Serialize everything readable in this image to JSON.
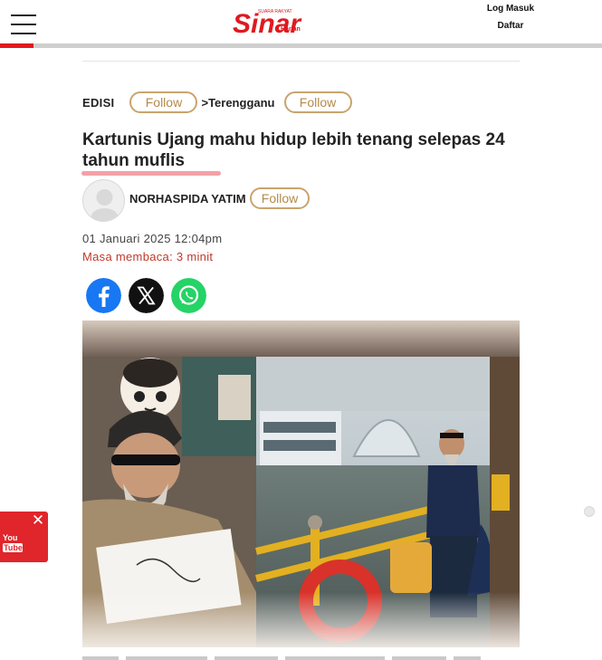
{
  "header": {
    "logo_text": "Sinar",
    "logo_tagline_top": "SUARA RAKYAT",
    "logo_tagline_side": "Harian",
    "login_label": "Log Masuk",
    "register_label": "Daftar"
  },
  "reading_progress": {
    "fraction": 0.055
  },
  "breadcrumb": {
    "edition_label": "EDISI",
    "follow_label_1": "Follow",
    "separator": ">",
    "region": "Terengganu",
    "follow_label_2": "Follow"
  },
  "article": {
    "title": "Kartunis Ujang mahu hidup lebih tenang selepas 24 tahun muflis",
    "author": "NORHASPIDA YATIM",
    "author_follow_label": "Follow",
    "date": "01 Januari 2025 12:04pm",
    "reading_time": "Masa membaca: 3 minit"
  },
  "share": {
    "icons": [
      "facebook-icon",
      "x-icon",
      "whatsapp-icon"
    ]
  },
  "youtube_widget": {
    "close_glyph": "✕",
    "logo_line1": "You",
    "logo_line2": "Tube"
  },
  "colors": {
    "brand_red": "#e0191f",
    "follow_gold": "#b58a4a",
    "reading_time_red": "#c0392b",
    "facebook_blue": "#1877f2",
    "whatsapp_green": "#25d366"
  }
}
